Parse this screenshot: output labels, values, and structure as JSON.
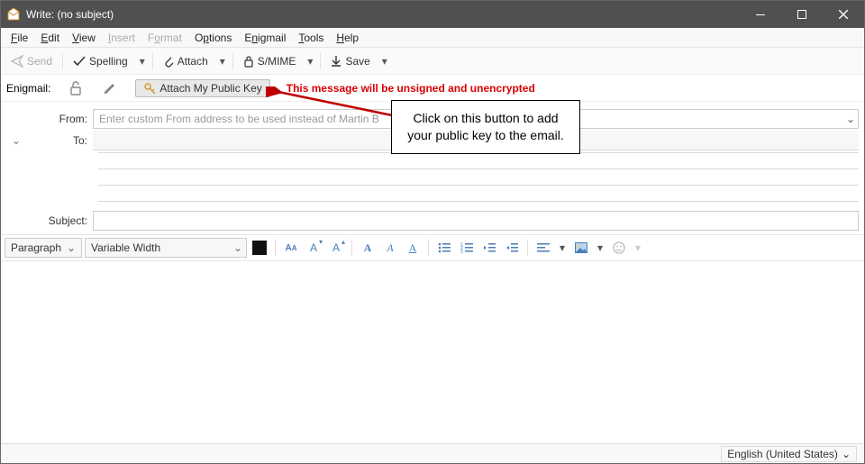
{
  "window": {
    "title": "Write: (no subject)"
  },
  "menu": {
    "file": "File",
    "edit": "Edit",
    "view": "View",
    "insert": "Insert",
    "format": "Format",
    "options": "Options",
    "enigmail": "Enigmail",
    "tools": "Tools",
    "help": "Help"
  },
  "toolbar": {
    "send": "Send",
    "spelling": "Spelling",
    "attach": "Attach",
    "smime": "S/MIME",
    "save": "Save"
  },
  "enigmail": {
    "label": "Enigmail:",
    "attach_key": "Attach My Public Key",
    "warning": "This message will be unsigned and unencrypted"
  },
  "headers": {
    "from_label": "From:",
    "from_placeholder": "Enter custom From address to be used instead of Martin B",
    "to_label": "To:",
    "subject_label": "Subject:",
    "subject_value": ""
  },
  "format": {
    "para_style": "Paragraph",
    "font_family": "Variable Width"
  },
  "status": {
    "language": "English (United States)"
  },
  "callout": {
    "text": "Click on this button to add your public key to the email."
  }
}
